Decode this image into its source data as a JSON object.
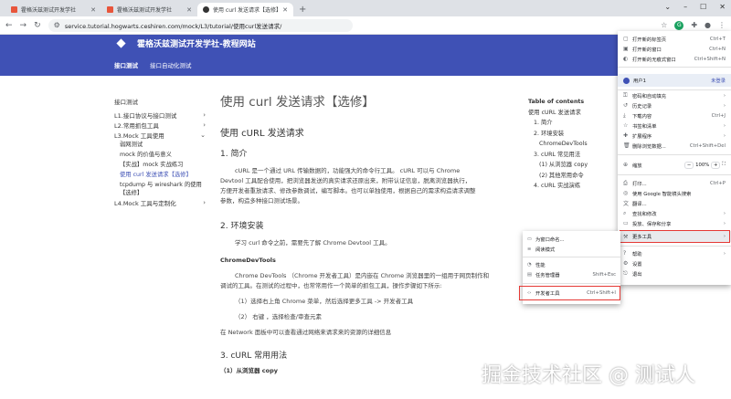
{
  "browser": {
    "tabs": [
      {
        "title": "霍格沃兹测试开发学社",
        "active": false
      },
      {
        "title": "霍格沃兹测试开发学社",
        "active": false
      },
      {
        "title": "使用 curl 发送请求【选修】",
        "active": true
      }
    ],
    "url": "service.tutorial.hogwarts.ceshiren.com/mock/L3/tutorial/使用curl发送请求/",
    "extension_badge": "G"
  },
  "site": {
    "title": "霍格沃兹测试开发学社-教程网站",
    "nav": [
      "接口测试",
      "接口自动化测试"
    ]
  },
  "sidebar": {
    "heading": "接口测试",
    "items": [
      {
        "label": "L1.接口协议与接口测试"
      },
      {
        "label": "L2.常用抓包工具"
      },
      {
        "label": "L3.Mock 工具使用"
      }
    ],
    "subitems": [
      "弱网测试",
      "mock 的价值与意义",
      "【实战】mock 实战练习",
      "使用 curl 发送请求【选修】",
      "tcpdump 与 wireshark 的使用",
      "【选修】"
    ],
    "last_item": "L4.Mock 工具与定制化"
  },
  "article": {
    "title": "使用 curl 发送请求【选修】",
    "h2a": "使用 cURL 发送请求",
    "h3_intro": "1. 简介",
    "intro_lines": [
      "cURL 是一个通过 URL 传输数据的，功能强大的命令行工具。 cURL 可以与 Chrome",
      "Devtool 工具配合使用，把浏览器发送的真实请求还原出来，附带认证信息，脱离浏览器执行，",
      "方便开发者重放请求、修改参数调试，编写脚本。也可以单独使用，根据自己的需求构造请求调整",
      "参数，构造多种接口测试场景。"
    ],
    "h3_env": "2. 环境安装",
    "env_line": "学习 curl 命令之前，需要先了解 Chrome Devtool 工具。",
    "h4_devtools": "ChromeDevTools",
    "devtools_lines": [
      "Chrome DevTools （Chrome 开发者工具）是内嵌在 Chrome 浏览器里的一组用于网页制作和",
      "调试的工具。在测试的过程中，也常常用作一个简单的抓包工具，操作步骤如下所示:"
    ],
    "step1": "（1）选择右上角 Chrome 菜单，然后选择更多工具 -> 开发者工具",
    "step2": "（2） 右键 ，选择检查/审查元素",
    "network_line": "在 Network 面板中可以查看通过网络来请求来的资源的详细信息",
    "h3_usage": "3. cURL 常用用法",
    "h4_copy": "（1）从浏览器 copy"
  },
  "toc": {
    "title": "Table of contents",
    "items": [
      "使用 cURL 发送请求",
      "1. 简介",
      "2. 环境安装",
      "ChromeDevTools",
      "3. cURL 常见用法",
      "(1) 从浏览器 copy",
      "(2) 其他常用命令",
      "4. cURL 实战演练"
    ]
  },
  "chrome_menu": {
    "items": [
      {
        "label": "打开新的标签页",
        "shortcut": "Ctrl+T",
        "icon": "new-tab-icon"
      },
      {
        "label": "打开新的窗口",
        "shortcut": "Ctrl+N",
        "icon": "new-window-icon"
      },
      {
        "label": "打开新的无痕式窗口",
        "shortcut": "Ctrl+Shift+N",
        "icon": "incognito-icon"
      }
    ],
    "profile_label": "用户1",
    "profile_status": "未登录",
    "items2": [
      {
        "label": "密码和自动填充",
        "shortcut": "",
        "icon": "key-icon",
        "arrow": true
      },
      {
        "label": "历史记录",
        "shortcut": "",
        "icon": "history-icon",
        "arrow": true
      },
      {
        "label": "下载内容",
        "shortcut": "Ctrl+J",
        "icon": "download-icon",
        "arrow": false
      },
      {
        "label": "书签和清单",
        "shortcut": "",
        "icon": "star-icon",
        "arrow": true
      },
      {
        "label": "扩展程序",
        "shortcut": "",
        "icon": "puzzle-icon",
        "arrow": true
      },
      {
        "label": "删除浏览数据...",
        "shortcut": "Ctrl+Shift+Del",
        "icon": "trash-icon",
        "arrow": false
      }
    ],
    "zoom_label": "缩放",
    "zoom_minus": "−",
    "zoom_value": "100%",
    "zoom_plus": "+",
    "items3": [
      {
        "label": "打印...",
        "shortcut": "Ctrl+P",
        "icon": "print-icon",
        "arrow": false
      },
      {
        "label": "使用 Google 智能镜头搜索",
        "shortcut": "",
        "icon": "lens-icon",
        "arrow": false
      },
      {
        "label": "翻译...",
        "shortcut": "",
        "icon": "translate-icon",
        "arrow": false
      },
      {
        "label": "查找和修改",
        "shortcut": "",
        "icon": "find-icon",
        "arrow": true
      },
      {
        "label": "投放、保存和分享",
        "shortcut": "",
        "icon": "cast-icon",
        "arrow": true
      },
      {
        "label": "更多工具",
        "shortcut": "",
        "icon": "tools-icon",
        "arrow": true
      }
    ],
    "items4": [
      {
        "label": "帮助",
        "shortcut": "",
        "icon": "help-icon",
        "arrow": true
      },
      {
        "label": "设置",
        "shortcut": "",
        "icon": "settings-icon",
        "arrow": false
      },
      {
        "label": "退出",
        "shortcut": "",
        "icon": "exit-icon",
        "arrow": false
      }
    ]
  },
  "more_tools_menu": {
    "items": [
      {
        "label": "为窗口命名...",
        "shortcut": "",
        "icon": "window-name-icon"
      },
      {
        "label": "阅读模式",
        "shortcut": "",
        "icon": "reading-mode-icon"
      },
      {
        "label": "性能",
        "shortcut": "",
        "icon": "performance-icon"
      },
      {
        "label": "任务管理器",
        "shortcut": "Shift+Esc",
        "icon": "task-manager-icon"
      },
      {
        "label": "开发者工具",
        "shortcut": "Ctrl+Shift+I",
        "icon": "devtools-icon"
      }
    ]
  },
  "watermark": "掘金技术社区 @ 测试人",
  "colors": {
    "header": "#3f51b5",
    "highlight_box": "#e53935"
  }
}
